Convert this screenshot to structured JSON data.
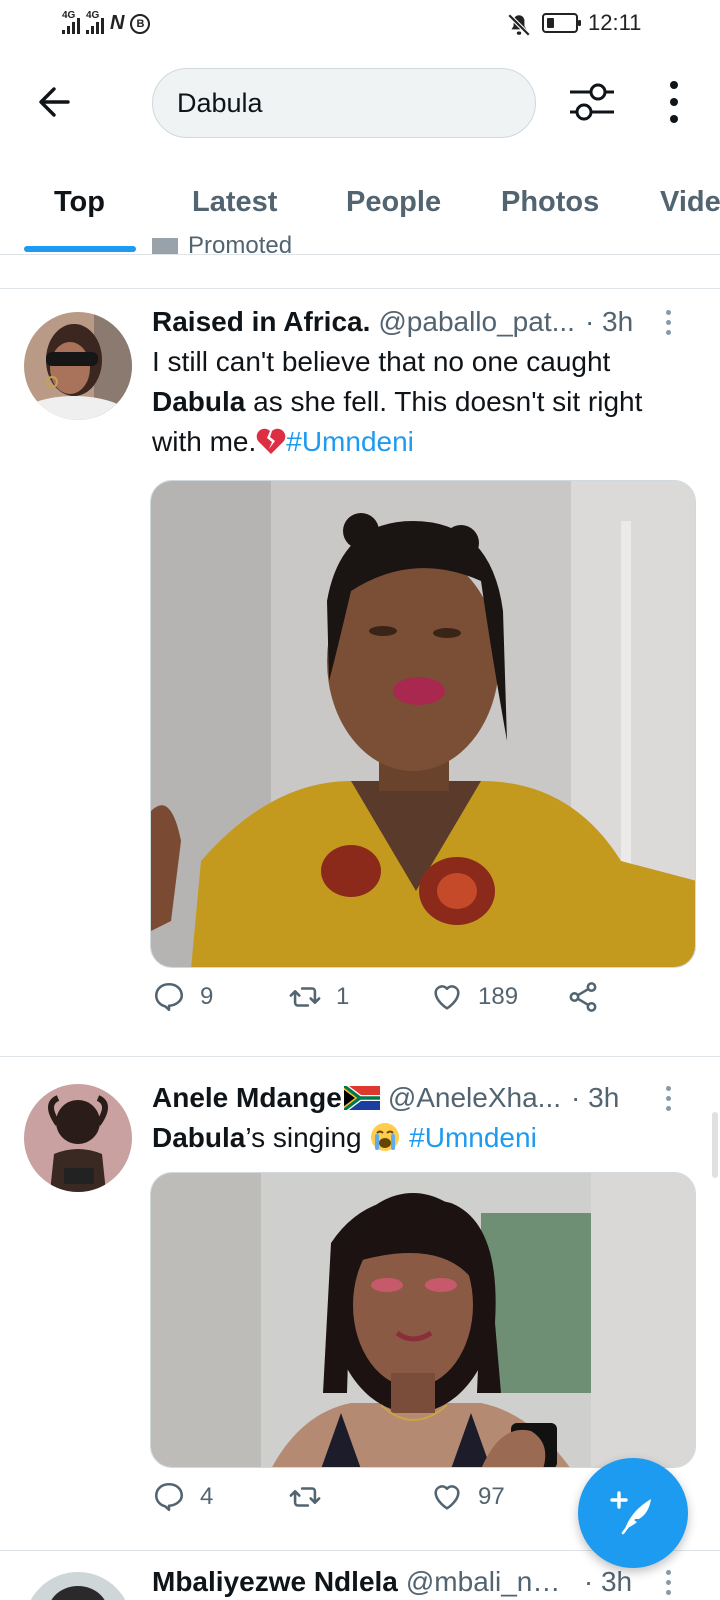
{
  "status_bar": {
    "net1": "4G",
    "net2": "4G",
    "time": "12:11"
  },
  "search": {
    "value": "Dabula"
  },
  "tabs": [
    {
      "label": "Top",
      "active": true
    },
    {
      "label": "Latest",
      "active": false
    },
    {
      "label": "People",
      "active": false
    },
    {
      "label": "Photos",
      "active": false
    },
    {
      "label": "Videos",
      "active": false
    }
  ],
  "promoted_label": "Promoted",
  "tweets": [
    {
      "name": "Raised in Africa.",
      "handle": "@paballo_pat...",
      "time": "· 3h",
      "text_pre": "I still can't believe that no one caught ",
      "text_bold": "Dabula",
      "text_post": " as she fell. This doesn't sit right with me.",
      "hashtag": "#Umndeni",
      "replies": "9",
      "retweets": "1",
      "likes": "189"
    },
    {
      "name": "Anele Mdange",
      "handle": "@AneleXha...",
      "time": "· 3h",
      "text_bold": "Dabula",
      "text_post": "’s singing ",
      "hashtag": "#Umndeni",
      "replies": "4",
      "retweets": "",
      "likes": "97"
    },
    {
      "name": "Mbaliyezwe Ndlela",
      "handle": "@mbali_ndl...",
      "time": "· 3h"
    }
  ],
  "colors": {
    "accent": "#1d9bf0",
    "text": "#0f1419",
    "muted": "#536471"
  }
}
